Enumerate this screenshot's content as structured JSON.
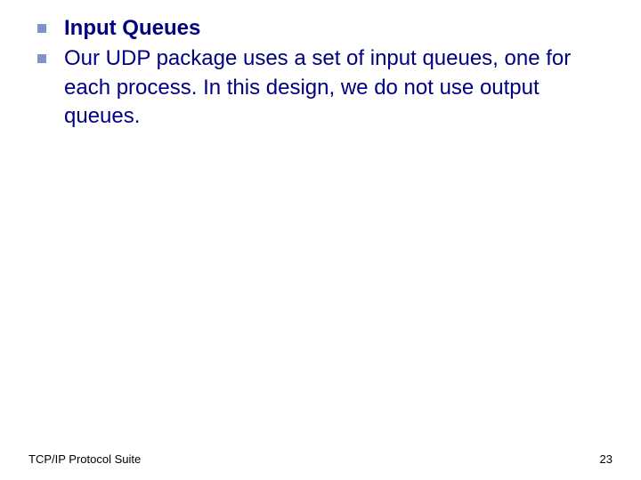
{
  "slide": {
    "items": [
      {
        "text": "Input Queues",
        "bold": true
      },
      {
        "text": "Our UDP package uses a set of input queues, one for each process. In this design, we do not use output queues.",
        "bold": false
      }
    ]
  },
  "footer": {
    "left": "TCP/IP Protocol Suite",
    "right": "23"
  }
}
